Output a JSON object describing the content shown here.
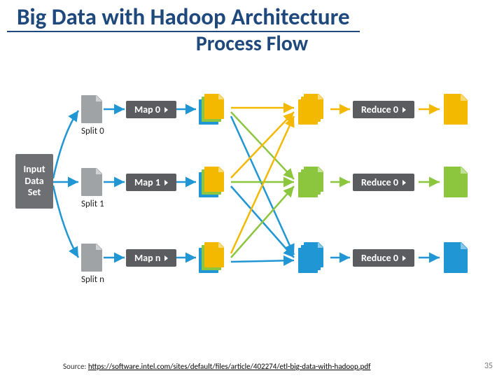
{
  "title": "Big Data with Hadoop Architecture",
  "subtitle": "Process Flow",
  "input_label": "Input\nData\nSet",
  "splits": [
    "Split 0",
    "Split 1",
    "Split n"
  ],
  "maps": [
    "Map 0",
    "Map 1",
    "Map n"
  ],
  "reduces": [
    "Reduce 0",
    "Reduce 0",
    "Reduce 0"
  ],
  "source_prefix": "Source: ",
  "source_url": "https://software.intel.com/sites/default/files/article/402274/etl-big-data-with-hadoop.pdf",
  "page_number": "35",
  "colors": {
    "heading": "#1f497d",
    "yellow": "#f3b800",
    "green": "#8cc63f",
    "blue": "#2196d4",
    "grey": "#6d6f72"
  }
}
